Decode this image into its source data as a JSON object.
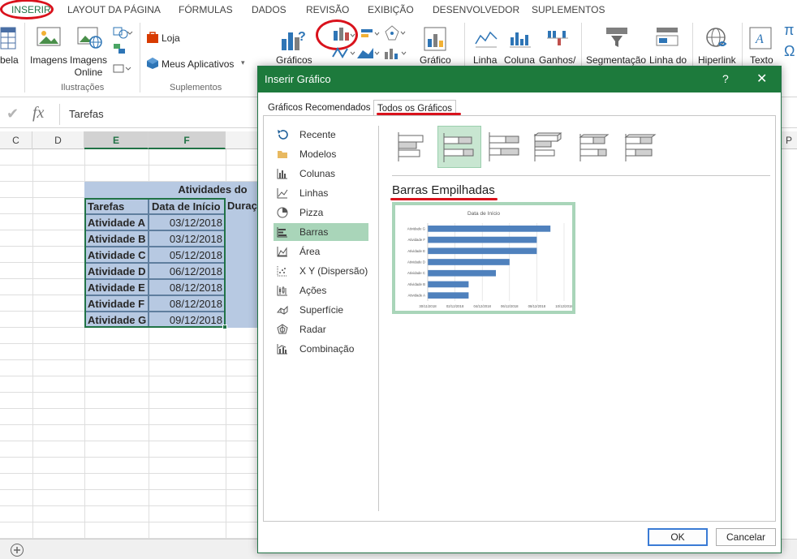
{
  "ribbon_tabs": [
    "INSERIR",
    "LAYOUT DA PÁGINA",
    "FÓRMULAS",
    "DADOS",
    "REVISÃO",
    "EXIBIÇÃO",
    "DESENVOLVEDOR",
    "SUPLEMENTOS"
  ],
  "ribbon": {
    "tabela_label": "bela",
    "imagens_label": "Imagens",
    "imagens_online_label": "Imagens Online",
    "group_ilustracoes": "Ilustrações",
    "loja_label": "Loja",
    "meus_aplicativos_label": "Meus Aplicativos",
    "group_suplementos": "Suplementos",
    "graficos_recomendados_label": "Gráficos",
    "grafico_dinamico_label": "Gráfico",
    "linha_label": "Linha",
    "coluna_label": "Coluna",
    "ganhos_label": "Ganhos/",
    "segmentacao_label": "Segmentação",
    "linha_do_tempo_label": "Linha do",
    "hiperlink_label": "Hiperlink",
    "texto_label": "Texto",
    "simbolo_pi": "π",
    "simbolo_omega": "Ω"
  },
  "formula_bar": {
    "fx": "fx",
    "value": "Tarefas"
  },
  "columns": [
    "C",
    "D",
    "E",
    "F",
    "P"
  ],
  "sheet": {
    "title": "Atividades do",
    "headers": [
      "Tarefas",
      "Data de Início",
      "Duraç"
    ],
    "rows": [
      {
        "task": "Atividade A",
        "date": "03/12/2018"
      },
      {
        "task": "Atividade B",
        "date": "03/12/2018"
      },
      {
        "task": "Atividade C",
        "date": "05/12/2018"
      },
      {
        "task": "Atividade D",
        "date": "06/12/2018"
      },
      {
        "task": "Atividade E",
        "date": "08/12/2018"
      },
      {
        "task": "Atividade F",
        "date": "08/12/2018"
      },
      {
        "task": "Atividade G",
        "date": "09/12/2018"
      }
    ]
  },
  "dialog": {
    "title": "Inserir Gráfico",
    "help": "?",
    "close": "✕",
    "tabs": [
      "Gráficos Recomendados",
      "Todos os Gráficos"
    ],
    "active_tab": "Todos os Gráficos",
    "nav": [
      {
        "label": "Recente",
        "icon": "recent-icon"
      },
      {
        "label": "Modelos",
        "icon": "folder-icon"
      },
      {
        "label": "Colunas",
        "icon": "column-chart-icon"
      },
      {
        "label": "Linhas",
        "icon": "line-chart-icon"
      },
      {
        "label": "Pizza",
        "icon": "pie-chart-icon"
      },
      {
        "label": "Barras",
        "icon": "bar-chart-icon"
      },
      {
        "label": "Área",
        "icon": "area-chart-icon"
      },
      {
        "label": "X Y (Dispersão)",
        "icon": "scatter-chart-icon"
      },
      {
        "label": "Ações",
        "icon": "stock-chart-icon"
      },
      {
        "label": "Superfície",
        "icon": "surface-chart-icon"
      },
      {
        "label": "Radar",
        "icon": "radar-chart-icon"
      },
      {
        "label": "Combinação",
        "icon": "combo-chart-icon"
      }
    ],
    "active_nav": "Barras",
    "subtype_title": "Barras Empilhadas",
    "ok": "OK",
    "cancel": "Cancelar"
  },
  "chart_data": {
    "type": "bar",
    "title": "Data de Início",
    "categories": [
      "Atividade G",
      "Atividade F",
      "Atividade E",
      "Atividade D",
      "Atividade C",
      "Atividade B",
      "Atividade A"
    ],
    "values": [
      "09/12/2018",
      "08/12/2018",
      "08/12/2018",
      "06/12/2018",
      "05/12/2018",
      "03/12/2018",
      "03/12/2018"
    ],
    "x_ticks": [
      "30/11/2018",
      "02/12/2018",
      "04/12/2018",
      "06/12/2018",
      "08/12/2018",
      "10/12/2018"
    ],
    "xlim": [
      "30/11/2018",
      "10/12/2018"
    ],
    "bar_color": "#4f81bd",
    "grid": true
  },
  "colors": {
    "excel_green": "#217346",
    "dialog_title": "#1d7a3c",
    "annotation_red": "#d9121c",
    "selected_cells": "#b7c9e2",
    "active_nav": "#a9d5b9"
  }
}
